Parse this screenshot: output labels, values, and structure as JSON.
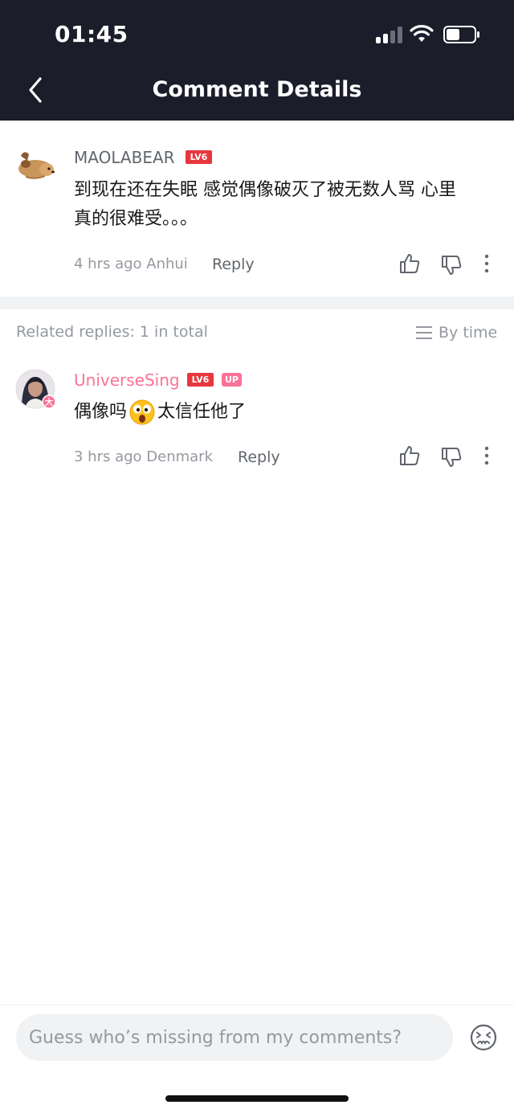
{
  "status_bar": {
    "time": "01:45"
  },
  "header": {
    "title": "Comment Details"
  },
  "main_comment": {
    "username": "MAOLABEAR",
    "level_badge": "LV6",
    "text_line1": "到现在还在失眠 感觉偶像破灭了被无数人骂 心里",
    "text_line2": "真的很难受。。。",
    "meta": "4 hrs ago Anhui",
    "reply_label": "Reply"
  },
  "replies_header": {
    "label": "Related replies: 1 in total",
    "sort_label": "By time"
  },
  "reply_comment": {
    "username": "UniverseSing",
    "level_badge": "LV6",
    "up_badge": "UP",
    "text_before_emoji": "偶像吗",
    "text_after_emoji": "太信任他了",
    "meta": "3 hrs ago Denmark",
    "reply_label": "Reply"
  },
  "comment_input": {
    "placeholder": "Guess who’s missing from my comments?"
  },
  "colors": {
    "header_bg": "#1c1d2b",
    "vip_pink": "#fb7299",
    "level_red": "#e6373d",
    "muted_gray": "#9499a0"
  }
}
